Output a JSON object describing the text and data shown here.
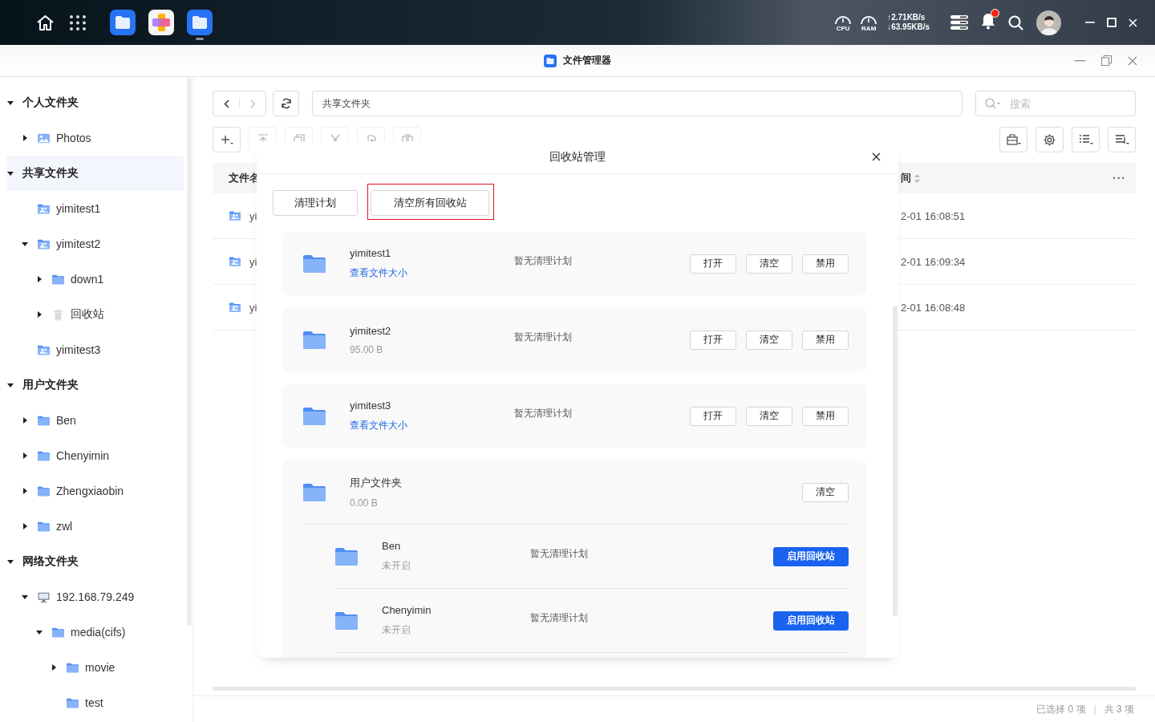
{
  "taskbar": {
    "apps": [
      {
        "kind": "files",
        "active": false
      },
      {
        "kind": "mixer",
        "active": false
      },
      {
        "kind": "files",
        "active": true
      }
    ],
    "cpu_label": "CPU",
    "ram_label": "RAM",
    "upload": "↑2.71KB/s",
    "download": "↓63.95KB/s",
    "notification_dot": true
  },
  "window": {
    "title": "文件管理器"
  },
  "sidebar": {
    "items": [
      {
        "label": "个人文件夹",
        "kind": "section",
        "expanded": true,
        "selected": false,
        "children": [
          {
            "label": "Photos",
            "kind": "photo",
            "expanded": false,
            "selected": false
          }
        ]
      },
      {
        "label": "共享文件夹",
        "kind": "section",
        "expanded": true,
        "selected": true,
        "children": [
          {
            "label": "yimitest1",
            "kind": "shared",
            "selected": false
          },
          {
            "label": "yimitest2",
            "kind": "shared",
            "expanded": true,
            "selected": false,
            "children": [
              {
                "label": "down1",
                "kind": "folder",
                "expanded": false,
                "selected": false
              },
              {
                "label": "回收站",
                "kind": "trash",
                "expanded": false,
                "selected": false
              }
            ]
          },
          {
            "label": "yimitest3",
            "kind": "shared",
            "selected": false
          }
        ]
      },
      {
        "label": "用户文件夹",
        "kind": "section",
        "expanded": true,
        "selected": false,
        "children": [
          {
            "label": "Ben",
            "kind": "folder",
            "expanded": false,
            "selected": false
          },
          {
            "label": "Chenyimin",
            "kind": "folder",
            "expanded": false,
            "selected": false
          },
          {
            "label": "Zhengxiaobin",
            "kind": "folder",
            "expanded": false,
            "selected": false
          },
          {
            "label": "zwl",
            "kind": "folder",
            "expanded": false,
            "selected": false
          }
        ]
      },
      {
        "label": "网络文件夹",
        "kind": "section",
        "expanded": true,
        "selected": false,
        "children": [
          {
            "label": "192.168.79.249",
            "kind": "computer",
            "expanded": true,
            "selected": false,
            "children": [
              {
                "label": "media(cifs)",
                "kind": "folder",
                "expanded": true,
                "selected": false,
                "children": [
                  {
                    "label": "movie",
                    "kind": "folder",
                    "expanded": false,
                    "selected": false
                  },
                  {
                    "label": "test",
                    "kind": "folder",
                    "selected": false
                  }
                ]
              }
            ]
          }
        ]
      }
    ]
  },
  "path": "共享文件夹",
  "search": {
    "placeholder": "搜索"
  },
  "toolbar": {
    "buttons": [
      {
        "kind": "add",
        "disabled": false
      },
      {
        "kind": "upload",
        "disabled": true
      },
      {
        "kind": "copy",
        "disabled": true
      },
      {
        "kind": "cut",
        "disabled": true
      },
      {
        "kind": "paste",
        "disabled": true
      },
      {
        "kind": "move",
        "disabled": true
      }
    ]
  },
  "table": {
    "columns": [
      "文件名",
      "间"
    ],
    "more": "···",
    "rows": [
      {
        "name": "yi",
        "time": "2-01 16:08:51"
      },
      {
        "name": "yi",
        "time": "2-01 16:09:34"
      },
      {
        "name": "yi",
        "time": "2-01 16:08:48"
      }
    ]
  },
  "status_bar": {
    "selected": "已选择 0 项",
    "separator": "|",
    "total": "共 3 项"
  },
  "dialog": {
    "title": "回收站管理",
    "actions": [
      {
        "label": "清理计划",
        "highlighted": false
      },
      {
        "label": "清空所有回收站",
        "highlighted": true
      }
    ],
    "shares": [
      {
        "name": "yimitest1",
        "detail": "查看文件大小",
        "kind": "link",
        "plan": "暂无清理计划",
        "buttons": [
          "打开",
          "清空",
          "禁用"
        ]
      },
      {
        "name": "yimitest2",
        "detail": "95.00 B",
        "kind": "size",
        "plan": "暂无清理计划",
        "buttons": [
          "打开",
          "清空",
          "禁用"
        ]
      },
      {
        "name": "yimitest3",
        "detail": "查看文件大小",
        "kind": "link",
        "plan": "暂无清理计划",
        "buttons": [
          "打开",
          "清空",
          "禁用"
        ]
      }
    ],
    "user_group": {
      "name": "用户文件夹",
      "size": "0.00 B",
      "buttons": [
        "清空"
      ],
      "users": [
        {
          "name": "Ben",
          "status": "未开启",
          "plan": "暂无清理计划",
          "button": "启用回收站"
        },
        {
          "name": "Chenyimin",
          "status": "未开启",
          "plan": "暂无清理计划",
          "button": "启用回收站"
        }
      ]
    }
  }
}
